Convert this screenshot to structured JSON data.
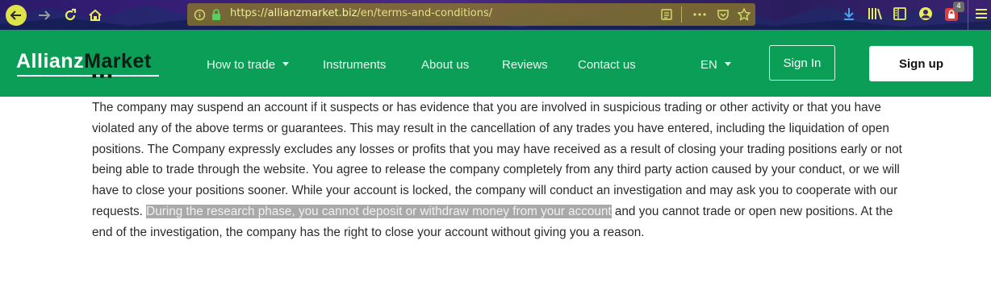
{
  "browser": {
    "url_prefix": "https://",
    "url_domain": "allianzmarket.biz",
    "url_path": "/en/terms-and-conditions/",
    "notification_count": "4"
  },
  "site": {
    "logo_part1": "Allianz",
    "logo_part2": "Market",
    "nav": [
      "How to trade",
      "Instruments",
      "About us",
      "Reviews",
      "Contact us"
    ],
    "language": "EN",
    "signin": "Sign In",
    "signup": "Sign up",
    "colors": {
      "header_bg": "#0a9e56",
      "highlight_bg": "#a9a9a9"
    }
  },
  "content": {
    "text_before": "The company may suspend an account if it suspects or has evidence that you are involved in suspicious trading or other activity or that you have violated any of the above terms or guarantees. This may result in the cancellation of any trades you have entered, including the liquidation of open positions. The Company expressly excludes any losses or profits that you may have received as a result of closing your trading positions early or not being able to trade through the website. You agree to release the company completely from any third party action caused by your conduct, or we will have to close your positions sooner. While your account is locked, the company will conduct an investigation and may ask you to cooperate with our requests. ",
    "text_highlight": "During the research phase, you cannot deposit or withdraw money from your account",
    "text_after": " and you cannot trade or open new positions. At the end of the investigation, the company has the right to close your account without giving you a reason."
  }
}
